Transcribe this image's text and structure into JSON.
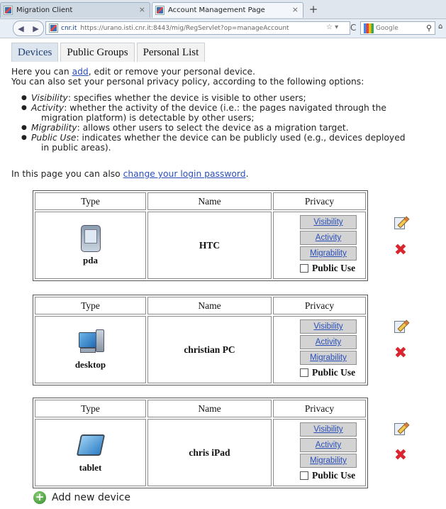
{
  "browser": {
    "tabs": [
      {
        "title": "Migration Client"
      },
      {
        "title": "Account Management Page"
      }
    ],
    "url_site": "cnr.it",
    "url": "https://urano.isti.cnr.it:8443/mig/RegServlet?op=manageAccount",
    "search_engine": "Google"
  },
  "app_tabs": [
    "Devices",
    "Public Groups",
    "Personal List"
  ],
  "intro": {
    "line1_pre": "Here you can ",
    "line1_link": "add",
    "line1_post": ", edit or remove your personal device.",
    "line2": "You can also set your personal privacy policy, according to the following options:"
  },
  "options": [
    {
      "term": "Visibility",
      "desc": ": specifies whether the device is visible to other users;",
      "cont": ""
    },
    {
      "term": "Activity",
      "desc": ": whether the activity of the device (i.e.: the pages navigated through the",
      "cont": "migration platform) is detectable by other users;"
    },
    {
      "term": "Migrability",
      "desc": ": allows other users to select the device as a migration target.",
      "cont": ""
    },
    {
      "term": "Public Use",
      "desc": ": indicates whether the device can be publicly used (e.g., devices deployed",
      "cont": "in public areas)."
    }
  ],
  "change_password": {
    "pre": "In this page you can also ",
    "link": "change your login password",
    "post": "."
  },
  "table_headers": {
    "type": "Type",
    "name": "Name",
    "privacy": "Privacy"
  },
  "privacy_buttons": {
    "visibility": "Visibility",
    "activity": "Activity",
    "migrability": "Migrability",
    "public_use": "Public Use"
  },
  "devices": [
    {
      "type": "pda",
      "name": "HTC",
      "icon": "pda-icon",
      "public_use": false
    },
    {
      "type": "desktop",
      "name": "christian PC",
      "icon": "desktop-icon",
      "public_use": false
    },
    {
      "type": "tablet",
      "name": "chris iPad",
      "icon": "tablet-icon",
      "public_use": false
    }
  ],
  "add_device": "Add new device"
}
